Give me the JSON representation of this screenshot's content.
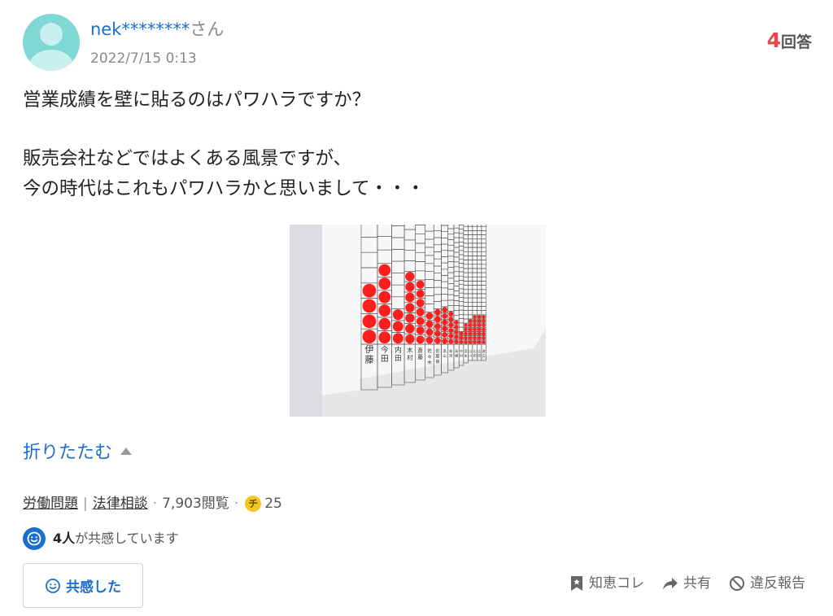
{
  "question": {
    "user": {
      "name": "nek********",
      "suffix": "さん"
    },
    "date": "2022/7/15 0:13",
    "answers": {
      "count": "4",
      "label": "回答"
    },
    "title": "営業成績を壁に貼るのはパワハラですか？",
    "body": "販売会社などではよくある風景ですが、\n今の時代はこれもパワハラかと思いまして・・・",
    "collapse_label": "折りたたむ",
    "categories": [
      "労働問題",
      "法律相談"
    ],
    "views": "7,903閲覧",
    "coins": "25",
    "coin_symbol": "チ",
    "empathy": {
      "count_text": "4人",
      "text": "が共感しています"
    },
    "empathy_button": "共感した",
    "actions": {
      "bookmark": "知恵コレ",
      "share": "共有",
      "report": "違反報告"
    }
  },
  "image": {
    "names": [
      "伊藤",
      "今田",
      "内田",
      "木村",
      "斎藤",
      "佐々木",
      "佐藤良",
      "高山",
      "新田",
      "高橋",
      "中村",
      "宮本",
      "山川",
      "山田",
      "吉田",
      "渡辺"
    ],
    "dots": [
      4,
      6,
      3,
      7,
      7,
      4,
      5,
      6,
      6,
      5,
      3,
      5,
      6,
      7,
      7,
      7
    ],
    "colors": {
      "dot": "#ff1e1e",
      "grid": "#555555",
      "wall": "#e9eaea"
    }
  },
  "colors": {
    "accent": "#1a6fce",
    "answer_count": "#e8474c",
    "avatar": "#7fd8d3"
  }
}
